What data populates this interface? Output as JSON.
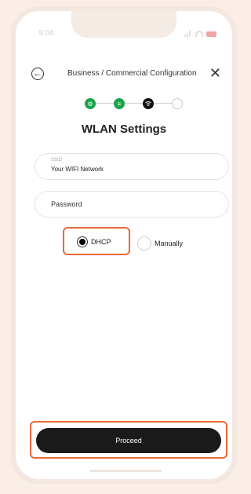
{
  "status_bar": {
    "time": "9:04"
  },
  "header": {
    "back_icon": "back-arrow-icon",
    "title": "Business / Commercial Configuration",
    "close_icon": "close-icon"
  },
  "stepper": {
    "steps": [
      {
        "icon": "gear-icon",
        "state": "complete"
      },
      {
        "icon": "list-icon",
        "state": "complete"
      },
      {
        "icon": "wifi-icon",
        "state": "active"
      },
      {
        "icon": "ellipsis-icon",
        "state": "pending"
      }
    ]
  },
  "page": {
    "title": "WLAN Settings"
  },
  "ssid": {
    "label": "SSID",
    "value": "Your WIFI Network"
  },
  "password": {
    "placeholder": "Password"
  },
  "ip_mode": {
    "options": [
      "DHCP",
      "Manually"
    ],
    "selected": "DHCP"
  },
  "actions": {
    "proceed": "Proceed"
  },
  "colors": {
    "accent_green": "#1aa34a",
    "highlight_orange": "#e8683a",
    "button_dark": "#1a1a1a"
  }
}
